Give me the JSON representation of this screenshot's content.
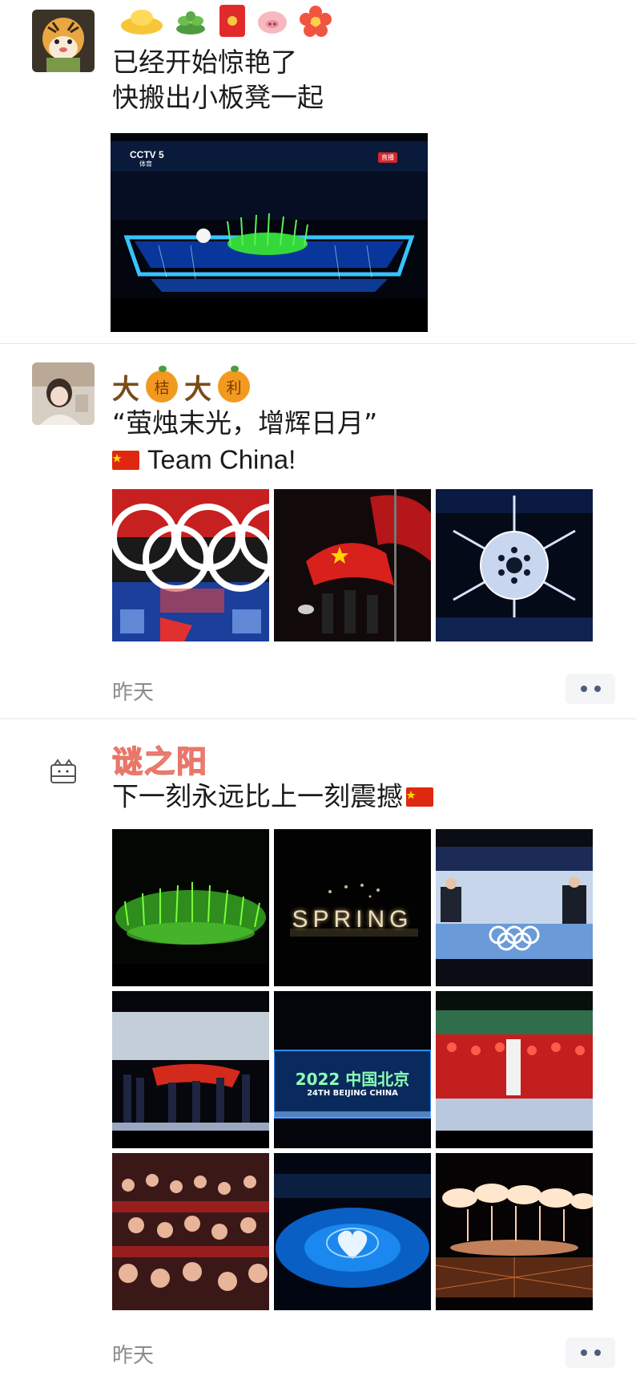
{
  "posts": [
    {
      "lines": [
        "已经开始惊艳了",
        "快搬出小板凳一起"
      ],
      "nickname_emojis": [
        "gold-ingot-icon",
        "plant-icon",
        "red-envelope-icon",
        "pig-icon",
        "flower-icon"
      ],
      "video": {
        "channel_logo": "CCTV 5",
        "channel_sub": "体育",
        "live_badge": "直播"
      }
    },
    {
      "nickname_glyphs": [
        "大",
        "桔",
        "大",
        "利"
      ],
      "lines": [
        "“萤烛末光，增辉日月”",
        "Team China!"
      ],
      "images": [
        "olympic-rings-flag",
        "chinese-flag-raising",
        "snowflake-torch"
      ],
      "time": "昨天"
    },
    {
      "nickname": "谜之阳",
      "lines": [
        "下一刻永远比上一刻震撼"
      ],
      "images": [
        {
          "id": "green-light-grass",
          "caption": ""
        },
        {
          "id": "spring-fireworks",
          "caption": "SPRING"
        },
        {
          "id": "leaders-rings",
          "caption": ""
        },
        {
          "id": "flag-ceremony",
          "caption": ""
        },
        {
          "id": "beijing-screen",
          "caption_1": "2022 中国北京",
          "caption_2": "24TH BEIJING CHINA"
        },
        {
          "id": "red-performers",
          "caption": ""
        },
        {
          "id": "crowd",
          "caption": ""
        },
        {
          "id": "heart-stage",
          "caption": ""
        },
        {
          "id": "fireworks-stage",
          "caption": ""
        }
      ],
      "time": "昨天"
    }
  ],
  "colors": {
    "time": "#8a8a8a",
    "more_dots": "#4c5d80",
    "divider": "#e6e6e6"
  }
}
